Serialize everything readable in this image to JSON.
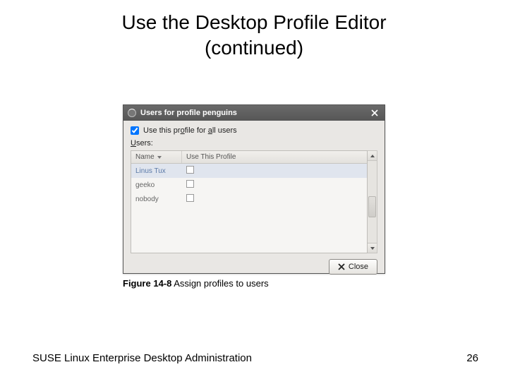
{
  "slide": {
    "title_line1": "Use the Desktop Profile Editor",
    "title_line2": "(continued)"
  },
  "window": {
    "title": "Users for profile penguins",
    "use_all_checked": true,
    "use_all_prefix": "Use this pr",
    "use_all_u1": "o",
    "use_all_mid": "file for ",
    "use_all_u2": "a",
    "use_all_suffix": "ll users",
    "users_label_u": "U",
    "users_label_rest": "sers:",
    "columns": {
      "name": "Name",
      "use": "Use This Profile"
    },
    "rows": [
      {
        "name": "Linus Tux",
        "checked": false,
        "selected": true
      },
      {
        "name": "geeko",
        "checked": false,
        "selected": false
      },
      {
        "name": "nobody",
        "checked": false,
        "selected": false
      }
    ],
    "close_label": "Close"
  },
  "caption": {
    "label": "Figure 14-8",
    "text": " Assign profiles to users"
  },
  "footer": {
    "left": "SUSE Linux Enterprise Desktop Administration",
    "page": "26"
  }
}
